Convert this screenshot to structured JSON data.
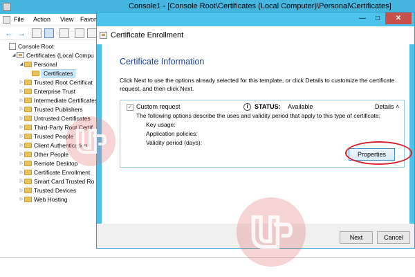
{
  "mmc": {
    "title": "Console1 - [Console Root\\Certificates (Local Computer)\\Personal\\Certificates]",
    "menu": [
      "File",
      "Action",
      "View",
      "Favori"
    ],
    "tree": [
      {
        "label": "Console Root",
        "indent": 0,
        "icon": "root",
        "expander": ""
      },
      {
        "label": "Certificates (Local Compu",
        "indent": 1,
        "icon": "cert-store",
        "expander": "open"
      },
      {
        "label": "Personal",
        "indent": 2,
        "icon": "folder",
        "expander": "open"
      },
      {
        "label": "Certificates",
        "indent": 3,
        "icon": "folder",
        "expander": "",
        "selected": true
      },
      {
        "label": "Trusted Root Certificat",
        "indent": 2,
        "icon": "folder",
        "expander": "closed"
      },
      {
        "label": "Enterprise Trust",
        "indent": 2,
        "icon": "folder",
        "expander": "closed"
      },
      {
        "label": "Intermediate Certificates",
        "indent": 2,
        "icon": "folder",
        "expander": "closed"
      },
      {
        "label": "Trusted Publishers",
        "indent": 2,
        "icon": "folder",
        "expander": "closed"
      },
      {
        "label": "Untrusted Certificates",
        "indent": 2,
        "icon": "folder",
        "expander": "closed"
      },
      {
        "label": "Third-Party Root Certif",
        "indent": 2,
        "icon": "folder",
        "expander": "closed"
      },
      {
        "label": "Trusted People",
        "indent": 2,
        "icon": "folder",
        "expander": "closed"
      },
      {
        "label": "Client Authentication I",
        "indent": 2,
        "icon": "folder",
        "expander": "closed"
      },
      {
        "label": "Other People",
        "indent": 2,
        "icon": "folder",
        "expander": "closed"
      },
      {
        "label": "Remote Desktop",
        "indent": 2,
        "icon": "folder",
        "expander": "closed"
      },
      {
        "label": "Certificate Enrollment",
        "indent": 2,
        "icon": "folder",
        "expander": "closed"
      },
      {
        "label": "Smart Card Trusted Ro",
        "indent": 2,
        "icon": "folder",
        "expander": "closed"
      },
      {
        "label": "Trusted Devices",
        "indent": 2,
        "icon": "folder",
        "expander": "closed"
      },
      {
        "label": "Web Hosting",
        "indent": 2,
        "icon": "folder",
        "expander": "closed"
      }
    ]
  },
  "dialog": {
    "title": "Certificate Enrollment",
    "heading": "Certificate Information",
    "instructions": "Click Next to use the options already selected for this template, or click Details to customize the certificate request, and then click Next.",
    "template": {
      "name": "Custom request",
      "checked": true,
      "status_label": "STATUS:",
      "status_value": "Available",
      "details_label": "Details",
      "description": "The following options describe the uses and validity period that apply to this type of certificate:",
      "key_usage": "Key usage:",
      "application_policies": "Application policies:",
      "validity_period": "Validity period (days):",
      "properties_button": "Properties"
    },
    "next_button": "Next",
    "cancel_button": "Cancel"
  },
  "colors": {
    "titlebar": "#45b6e0",
    "dialog_frame": "#4dc3ec",
    "heading": "#1e3f91",
    "highlight_circle": "#d9202a",
    "close_button": "#c7504a",
    "watermark": "#e47070"
  },
  "icons": {
    "back": "arrow-left-icon",
    "forward": "arrow-right-icon",
    "info": "info-icon",
    "details": "chevron-up-icon"
  }
}
